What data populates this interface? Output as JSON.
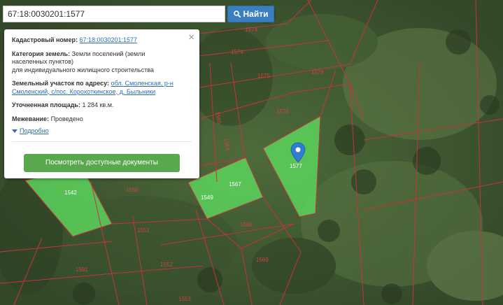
{
  "search": {
    "value": "67:18:0030201:1577",
    "button_label": "Найти"
  },
  "popup": {
    "cadastral_label": "Кадастровый номер:",
    "cadastral_value": "67:18:0030201:1577",
    "category_label": "Категория земель:",
    "category_value": "Земли поселений (земли",
    "category_line2": "населенных пунктов)",
    "category_line3": "для индивидуального жилищного строительства",
    "address_label": "Земельный участок по адресу:",
    "address_part1": "обл. Смоленская, р-н",
    "address_part2": "Смоленский, с/пос. Корохоткинское, д. Быльники",
    "area_label": "Уточненная площадь:",
    "area_value": "1 284 кв.м.",
    "survey_label": "Межевание:",
    "survey_value": "Проведено",
    "details_label": "Подробно",
    "docs_button": "Посмотреть доступные документы",
    "close_symbol": "×"
  },
  "parcels": [
    "1574",
    "1574",
    "1575",
    "1578",
    "1576",
    "1577",
    "1567",
    "1568",
    "1569",
    "1550",
    "1551",
    "1552",
    "1553",
    "1591",
    "1542",
    "1549",
    "1565",
    "1564"
  ],
  "colors": {
    "parcel_border": "#c8333d",
    "highlight_fill": "#5cd35c",
    "button_blue": "#3a7fbf",
    "button_green": "#5aa84e",
    "link": "#2d6eb5",
    "marker": "#2f7cd1"
  },
  "icons": {
    "search_button": "search-icon",
    "close": "close-icon",
    "marker": "map-marker-icon",
    "details": "triangle-down-icon"
  }
}
